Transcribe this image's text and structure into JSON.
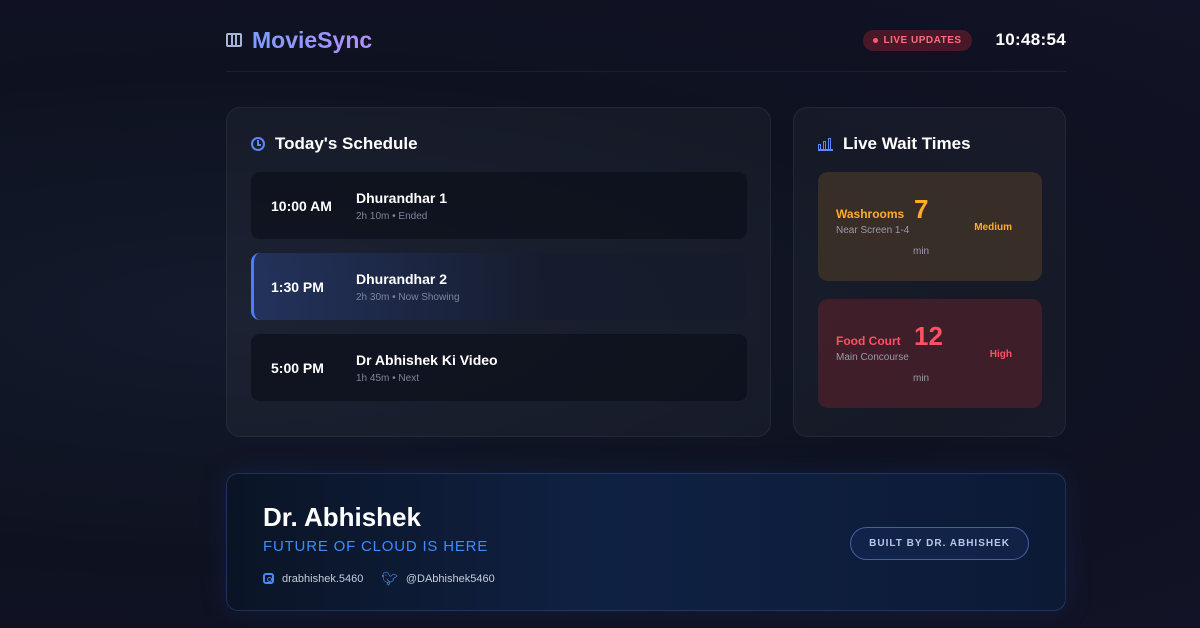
{
  "app": {
    "name": "MovieSync",
    "live_badge": "LIVE UPDATES",
    "clock": "10:48:54"
  },
  "schedule": {
    "title": "Today's Schedule",
    "items": [
      {
        "time": "10:00 AM",
        "title": "Dhurandhar 1",
        "duration": "2h 10m",
        "status": "Ended",
        "meta": "2h 10m • Ended",
        "active": false
      },
      {
        "time": "1:30 PM",
        "title": "Dhurandhar 2",
        "duration": "2h 30m",
        "status": "Now Showing",
        "meta": "2h 30m • Now Showing",
        "active": true
      },
      {
        "time": "5:00 PM",
        "title": "Dr Abhishek Ki Video",
        "duration": "1h 45m",
        "status": "Next",
        "meta": "1h 45m • Next",
        "active": false
      }
    ]
  },
  "wait_times": {
    "title": "Live Wait Times",
    "items": [
      {
        "name": "Washrooms",
        "location": "Near Screen 1-4",
        "value": "7",
        "unit": "min",
        "level": "Medium",
        "color": "#ffab2e"
      },
      {
        "name": "Food Court",
        "location": "Main Concourse",
        "value": "12",
        "unit": "min",
        "level": "High",
        "color": "#ff5065"
      }
    ]
  },
  "banner": {
    "name": "Dr. Abhishek",
    "tagline": "FUTURE OF CLOUD IS HERE",
    "instagram": "drabhishek.5460",
    "twitter": "@DAbhishek5460",
    "button": "BUILT BY DR. ABHISHEK"
  },
  "colors": {
    "accent": "#4f7cff",
    "live": "#ff5a6e",
    "medium": "#ffab2e",
    "high": "#ff5065",
    "tagline": "#3d8bff"
  },
  "icons": {
    "logo": "film-icon",
    "schedule": "clock-icon",
    "wait_times": "bar-chart-icon",
    "instagram": "instagram-icon",
    "twitter": "twitter-icon"
  }
}
